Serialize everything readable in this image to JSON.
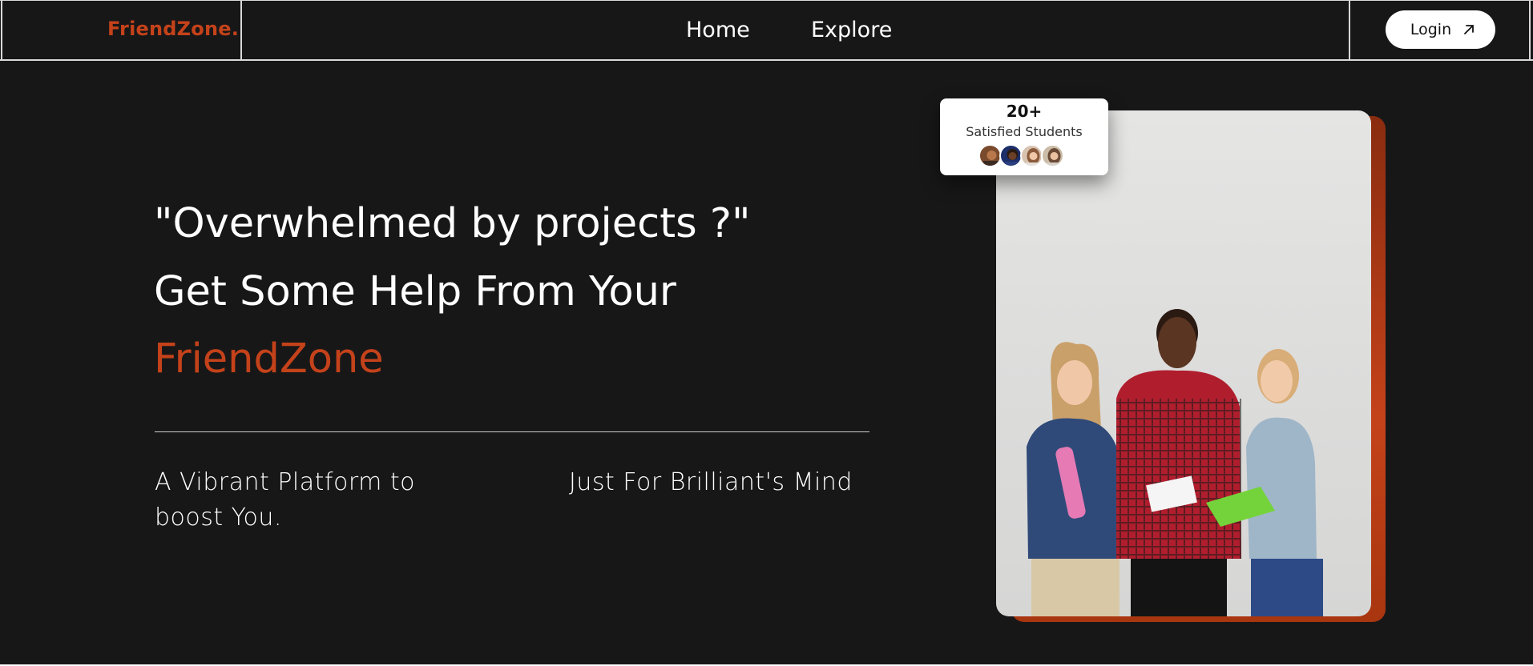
{
  "header": {
    "logo": "FriendZone.",
    "nav": [
      "Home",
      "Explore"
    ],
    "login_label": "Login"
  },
  "hero": {
    "line1": "\"Overwhelmed by projects ?\"",
    "line2": "Get Some Help From Your",
    "line3": "FriendZone",
    "sub_left": "A Vibrant Platform to boost You.",
    "sub_right": "Just For Brilliant's Mind"
  },
  "stats": {
    "count": "20+",
    "label": "Satisfied Students"
  },
  "colors": {
    "accent": "#c4421a",
    "background": "#181718",
    "text": "#ffffff"
  },
  "icons": {
    "login": "arrow-up-right-icon"
  }
}
